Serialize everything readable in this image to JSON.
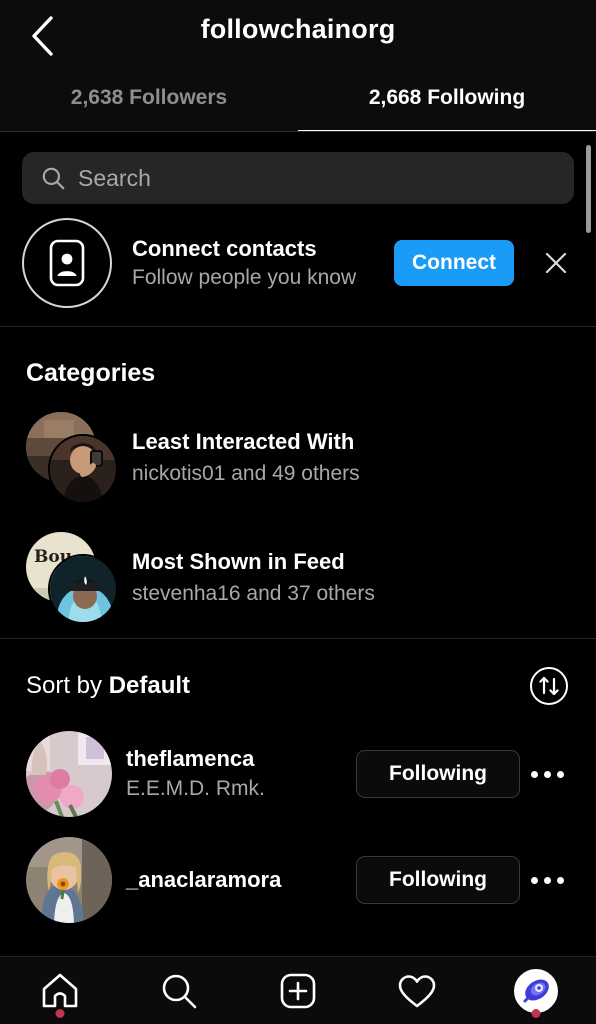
{
  "header": {
    "back_icon": "chevron-left-icon",
    "title": "followchainorg",
    "tabs": [
      {
        "label": "2,638 Followers",
        "active": false
      },
      {
        "label": "2,668 Following",
        "active": true
      }
    ]
  },
  "search": {
    "icon": "search-icon",
    "placeholder": "Search",
    "value": ""
  },
  "connect_contacts": {
    "icon": "contact-card-icon",
    "title": "Connect contacts",
    "subtitle": "Follow people you know",
    "button_label": "Connect",
    "close_icon": "close-icon",
    "button_color": "#1a9bf7"
  },
  "categories": {
    "heading": "Categories",
    "items": [
      {
        "title": "Least Interacted With",
        "subtitle": "nickotis01 and 49 others",
        "avatar": "stacked-avatar"
      },
      {
        "title": "Most Shown in Feed",
        "subtitle": "stevenha16 and 37 others",
        "avatar": "stacked-avatar"
      }
    ]
  },
  "sort": {
    "prefix": "Sort by ",
    "value": "Default",
    "icon": "sort-arrows-icon"
  },
  "users": [
    {
      "username": "theflamenca",
      "subtitle": "E.E.M.D. Rmk.",
      "button_label": "Following",
      "menu_icon": "more-options-icon"
    },
    {
      "username": "_anaclaramora",
      "subtitle": "",
      "button_label": "Following",
      "menu_icon": "more-options-icon"
    }
  ],
  "bottom_nav": [
    {
      "icon": "home-icon",
      "badge": true
    },
    {
      "icon": "search-icon",
      "badge": false
    },
    {
      "icon": "create-post-icon",
      "badge": false
    },
    {
      "icon": "heart-icon",
      "badge": false
    },
    {
      "icon": "profile-avatar-icon",
      "badge": true
    }
  ]
}
